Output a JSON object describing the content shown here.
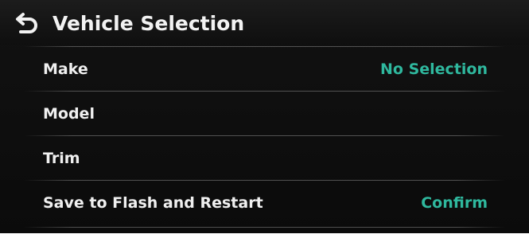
{
  "header": {
    "back_icon": "back-arrow-icon",
    "title": "Vehicle Selection"
  },
  "rows": [
    {
      "label": "Make",
      "value": "No Selection"
    },
    {
      "label": "Model",
      "value": ""
    },
    {
      "label": "Trim",
      "value": ""
    },
    {
      "label": "Save to Flash and Restart",
      "value": "Confirm"
    }
  ],
  "colors": {
    "background": "#0b0b0b",
    "text": "#f0f0f0",
    "accent": "#2fb89e"
  }
}
